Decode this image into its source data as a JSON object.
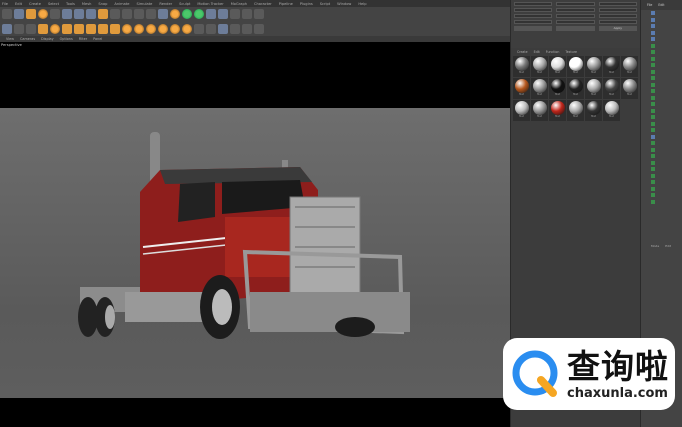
{
  "menu": [
    "File",
    "Edit",
    "Create",
    "Select",
    "Tools",
    "Mesh",
    "Snap",
    "Animate",
    "Simulate",
    "Render",
    "Sculpt",
    "Motion Tracker",
    "MoGraph",
    "Character",
    "Pipeline",
    "Plugins",
    "Script",
    "Window",
    "Help"
  ],
  "viewport": {
    "menu": [
      "View",
      "Cameras",
      "Display",
      "Options",
      "Filter",
      "Panel"
    ],
    "label": "Perspective"
  },
  "attributes": {
    "apply_label": "Apply"
  },
  "materials": {
    "tabs": [
      "Create",
      "Edit",
      "Function",
      "Texture"
    ],
    "items": [
      {
        "name": "Mat",
        "color": "#777"
      },
      {
        "name": "Mat",
        "color": "#aaa"
      },
      {
        "name": "Mat",
        "color": "#ddd"
      },
      {
        "name": "Mat",
        "color": "#fff"
      },
      {
        "name": "Mat",
        "color": "#999"
      },
      {
        "name": "Mat",
        "color": "#333"
      },
      {
        "name": "Mat",
        "color": "#888"
      },
      {
        "name": "Mat",
        "color": "#b5561c"
      },
      {
        "name": "Mat",
        "color": "#999"
      },
      {
        "name": "Mat",
        "color": "#111"
      },
      {
        "name": "Mat",
        "color": "#222"
      },
      {
        "name": "Mat",
        "color": "#aaa"
      },
      {
        "name": "Mat",
        "color": "#444"
      },
      {
        "name": "Mat",
        "color": "#888"
      },
      {
        "name": "Mat",
        "color": "#bbb"
      },
      {
        "name": "Mat",
        "color": "#999"
      },
      {
        "name": "Mat",
        "color": "#c0251a"
      },
      {
        "name": "Mat",
        "color": "#aaa"
      },
      {
        "name": "Mat",
        "color": "#333"
      },
      {
        "name": "Mat",
        "color": "#bbb"
      }
    ]
  },
  "objects": {
    "tabs": [
      "File",
      "Edit"
    ],
    "footer": [
      "Mode",
      "Edit"
    ]
  },
  "watermark": {
    "cn": "查询啦",
    "en": "chaxunla.com"
  }
}
